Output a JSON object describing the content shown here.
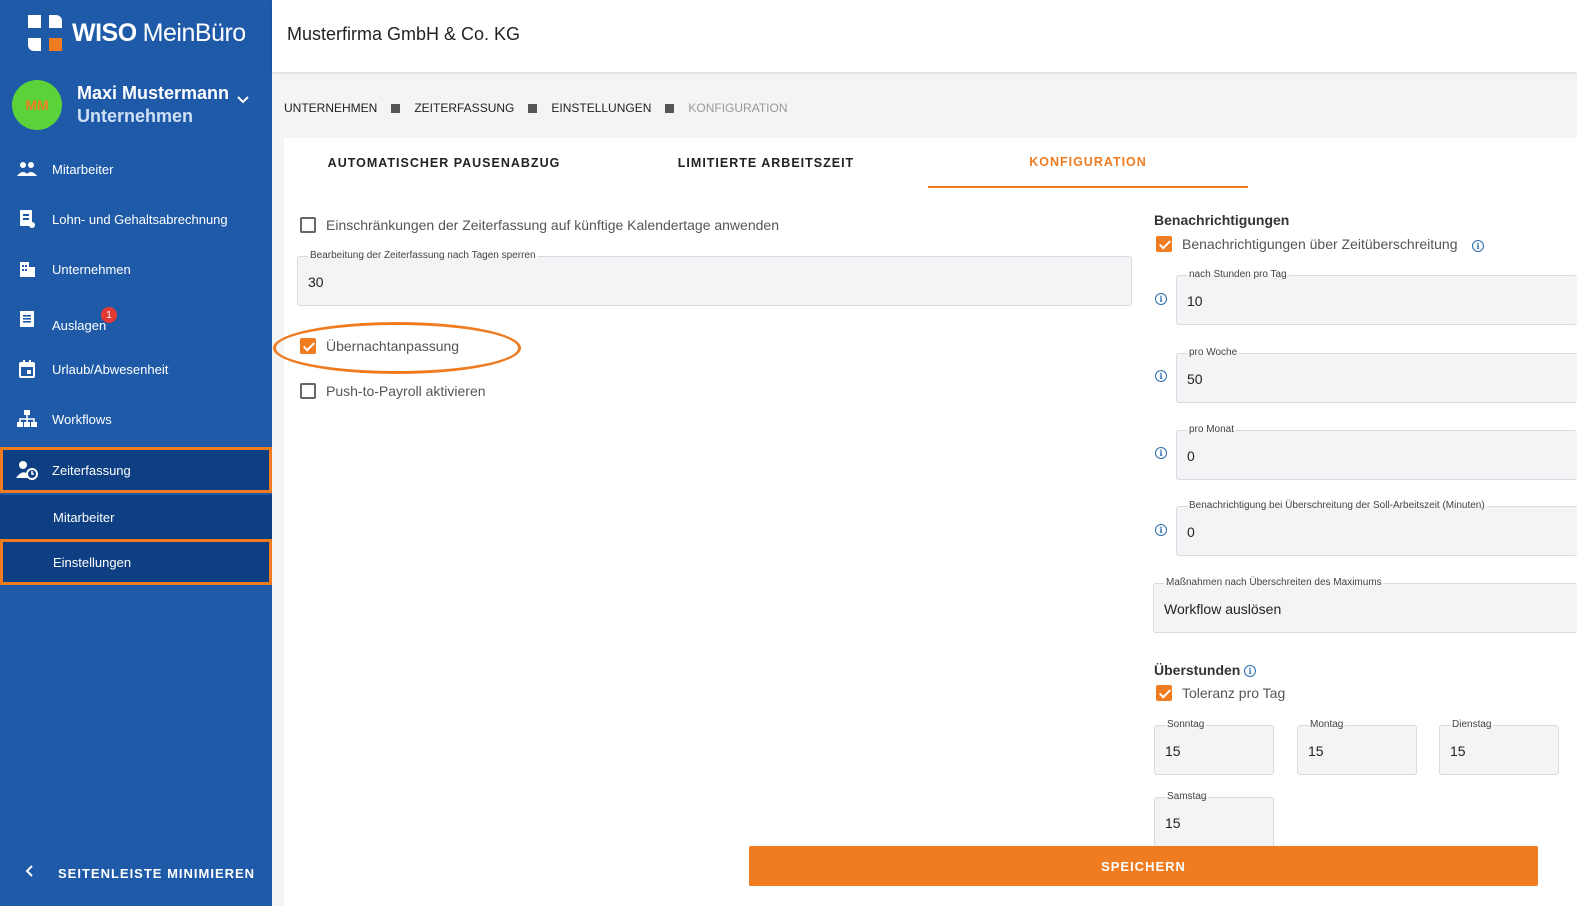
{
  "brand": {
    "logo_bold": "WISO",
    "logo_thin": "MeinBüro"
  },
  "user": {
    "initials": "MM",
    "name": "Maxi Mustermann",
    "role": "Unternehmen"
  },
  "nav": {
    "items": [
      {
        "label": "Mitarbeiter",
        "icon": "people-icon"
      },
      {
        "label": "Lohn- und Gehaltsabrechnung",
        "icon": "payroll-icon"
      },
      {
        "label": "Unternehmen",
        "icon": "building-icon"
      },
      {
        "label": "Auslagen",
        "icon": "receipt-icon",
        "badge": "1"
      },
      {
        "label": "Urlaub/Abwesenheit",
        "icon": "calendar-icon"
      },
      {
        "label": "Workflows",
        "icon": "workflow-icon"
      },
      {
        "label": "Zeiterfassung",
        "icon": "time-tracking-icon"
      }
    ],
    "sub_items": [
      {
        "label": "Mitarbeiter"
      },
      {
        "label": "Einstellungen"
      }
    ],
    "minimize_label": "SEITENLEISTE MINIMIEREN"
  },
  "header": {
    "company": "Musterfirma GmbH & Co. KG"
  },
  "breadcrumb": [
    "UNTERNEHMEN",
    "ZEITERFASSUNG",
    "EINSTELLUNGEN",
    "KONFIGURATION"
  ],
  "tabs": [
    {
      "label": "AUTOMATISCHER PAUSENABZUG",
      "active": false
    },
    {
      "label": "LIMITIERTE ARBEITSZEIT",
      "active": false
    },
    {
      "label": "KONFIGURATION",
      "active": true
    }
  ],
  "left": {
    "restrict_checkbox": {
      "label": "Einschränkungen der Zeiterfassung auf künftige Kalendertage anwenden",
      "checked": false
    },
    "lock_field": {
      "label": "Bearbeitung der Zeiterfassung nach Tagen sperren",
      "value": "30"
    },
    "overnight_checkbox": {
      "label": "Übernachtanpassung",
      "checked": true
    },
    "push_checkbox": {
      "label": "Push-to-Payroll aktivieren",
      "checked": false
    }
  },
  "notifications": {
    "title": "Benachrichtigungen",
    "exceed_checkbox": {
      "label": "Benachrichtigungen über Zeitüberschreitung",
      "checked": true
    },
    "per_day": {
      "label": "nach Stunden pro Tag",
      "value": "10"
    },
    "per_week": {
      "label": "pro Woche",
      "value": "50"
    },
    "per_month": {
      "label": "pro Monat",
      "value": "0"
    },
    "target_exceed": {
      "label": "Benachrichtigung bei Überschreitung der Soll-Arbeitszeit (Minuten)",
      "value": "0"
    },
    "actions": {
      "label": "Maßnahmen nach Überschreiten des Maximums",
      "value": "Workflow auslösen"
    }
  },
  "overtime": {
    "title": "Überstunden",
    "tolerance_checkbox": {
      "label": "Toleranz pro Tag",
      "checked": true
    },
    "days": [
      {
        "label": "Sonntag",
        "value": "15"
      },
      {
        "label": "Montag",
        "value": "15"
      },
      {
        "label": "Dienstag",
        "value": "15"
      },
      {
        "label": "Samstag",
        "value": "15"
      }
    ]
  },
  "save_label": "SPEICHERN",
  "colors": {
    "sidebar": "#1e5aa8",
    "sidebar_active": "#0d3f82",
    "accent": "#f07c22",
    "avatar": "#5bd23a"
  }
}
